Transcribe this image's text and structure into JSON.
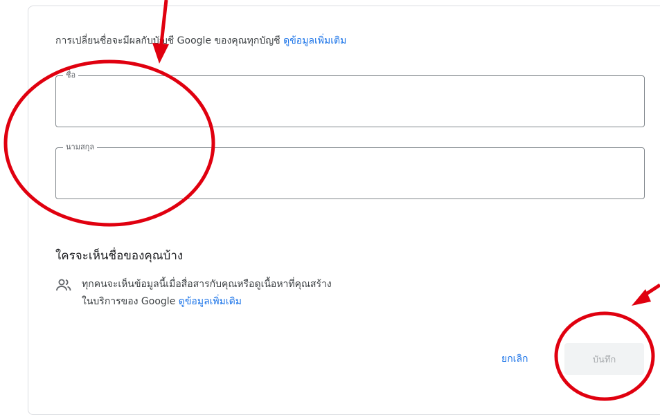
{
  "notice": {
    "text": "การเปลี่ยนชื่อจะมีผลกับบัญชี Google ของคุณทุกบัญชี",
    "link": "ดูข้อมูลเพิ่มเติม"
  },
  "fields": {
    "first_name": {
      "label": "ชื่อ",
      "value": ""
    },
    "last_name": {
      "label": "นามสกุล",
      "value": ""
    }
  },
  "visibility": {
    "title": "ใครจะเห็นชื่อของคุณบ้าง",
    "icon": "people-icon",
    "line1": "ทุกคนจะเห็นข้อมูลนี้เมื่อสื่อสารกับคุณหรือดูเนื้อหาที่คุณสร้าง",
    "line2_prefix": "ในบริการของ Google",
    "link": "ดูข้อมูลเพิ่มเติม"
  },
  "actions": {
    "cancel_label": "ยกเลิก",
    "save_label": "บันทึก"
  },
  "annotation": {
    "color": "#e0000f"
  }
}
